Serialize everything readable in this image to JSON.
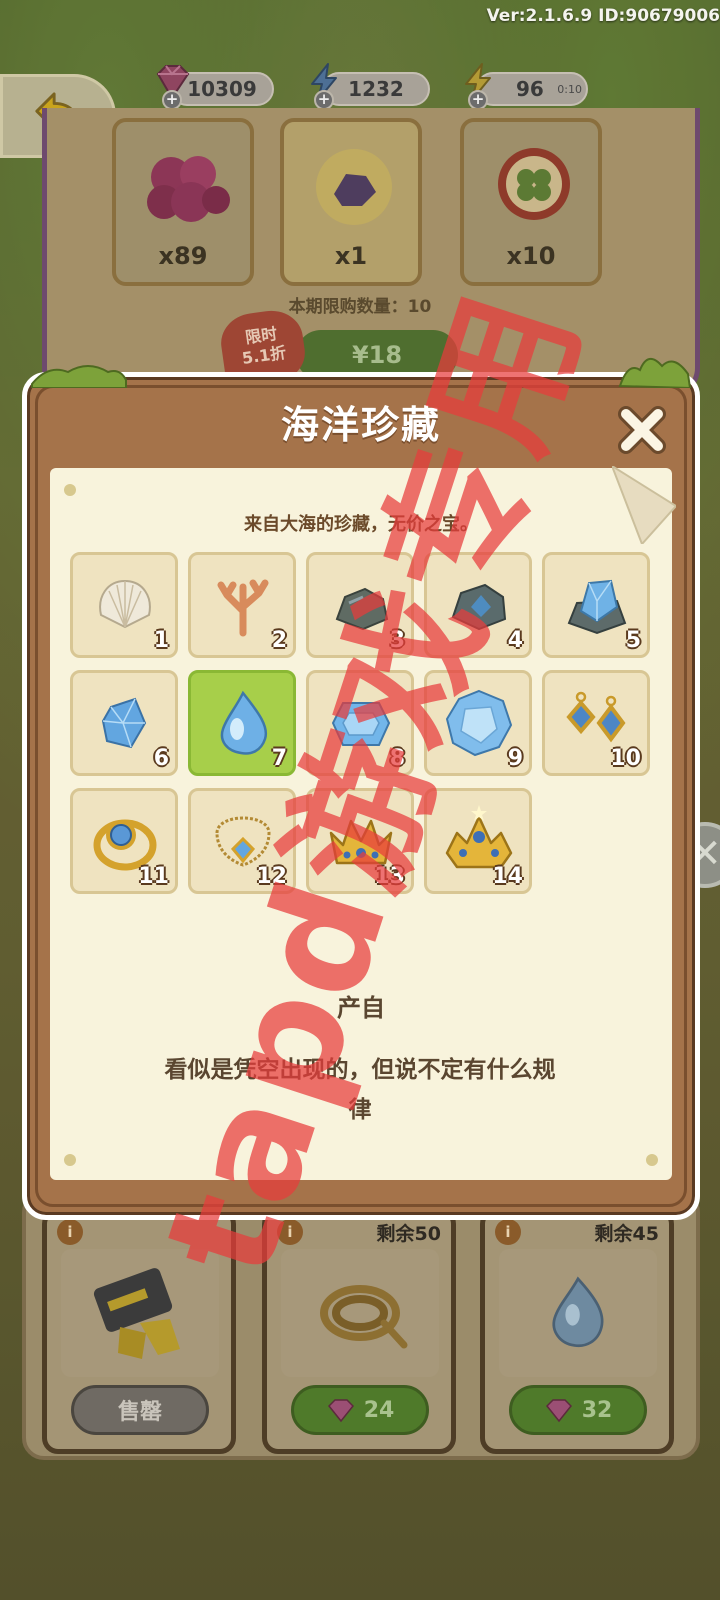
{
  "version": "Ver:2.1.6.9 ID:90679006",
  "resources": {
    "gems": {
      "value": "10309",
      "icon": "gem-icon"
    },
    "energy": {
      "value": "1232",
      "icon": "lightning-icon"
    },
    "stamina": {
      "value": "96",
      "timer": "0:10",
      "icon": "lightning-gold-icon"
    }
  },
  "shop": {
    "items": [
      {
        "qty": "x89",
        "icon": "ruby-cluster-icon"
      },
      {
        "qty": "x1",
        "icon": "purple-ore-icon"
      },
      {
        "qty": "x10",
        "icon": "clover-coin-icon"
      }
    ],
    "limit_text": "本期限购数量：10",
    "sale_tag": [
      "限时",
      "5.1折"
    ],
    "price": "¥18"
  },
  "modal": {
    "title": "海洋珍藏",
    "subtitle": "来自大海的珍藏，无价之宝。",
    "items": [
      {
        "num": "1",
        "icon": "shell-icon"
      },
      {
        "num": "2",
        "icon": "coral-icon"
      },
      {
        "num": "3",
        "icon": "rock-icon"
      },
      {
        "num": "4",
        "icon": "blue-ore-icon"
      },
      {
        "num": "5",
        "icon": "crystal-ore-icon"
      },
      {
        "num": "6",
        "icon": "small-gem-icon"
      },
      {
        "num": "7",
        "icon": "water-drop-gem-icon"
      },
      {
        "num": "8",
        "icon": "cut-gem-icon"
      },
      {
        "num": "9",
        "icon": "large-diamond-icon"
      },
      {
        "num": "10",
        "icon": "earrings-icon"
      },
      {
        "num": "11",
        "icon": "ring-icon"
      },
      {
        "num": "12",
        "icon": "necklace-icon"
      },
      {
        "num": "13",
        "icon": "crown-icon"
      },
      {
        "num": "14",
        "icon": "tiara-icon"
      }
    ],
    "selected_index": 6,
    "source_label": "产自",
    "source_desc": "看似是凭空出现的，但说不定有什么规律"
  },
  "bottom": {
    "cards": [
      {
        "remain": "",
        "button": "售罄",
        "icon": "diving-gear-icon",
        "style": "gray"
      },
      {
        "remain": "剩余50",
        "button": "24",
        "icon": "rope-icon",
        "style": "green"
      },
      {
        "remain": "剩余45",
        "button": "32",
        "icon": "water-drop-gem-icon",
        "style": "green"
      }
    ],
    "info_glyph": "i"
  },
  "watermark": "tapd游戏专用",
  "colors": {
    "modal_wood": "#a5734a",
    "paper": "#f8f3dc",
    "selected_cell": "#a7cf4a",
    "watermark": "#e83c3c"
  }
}
